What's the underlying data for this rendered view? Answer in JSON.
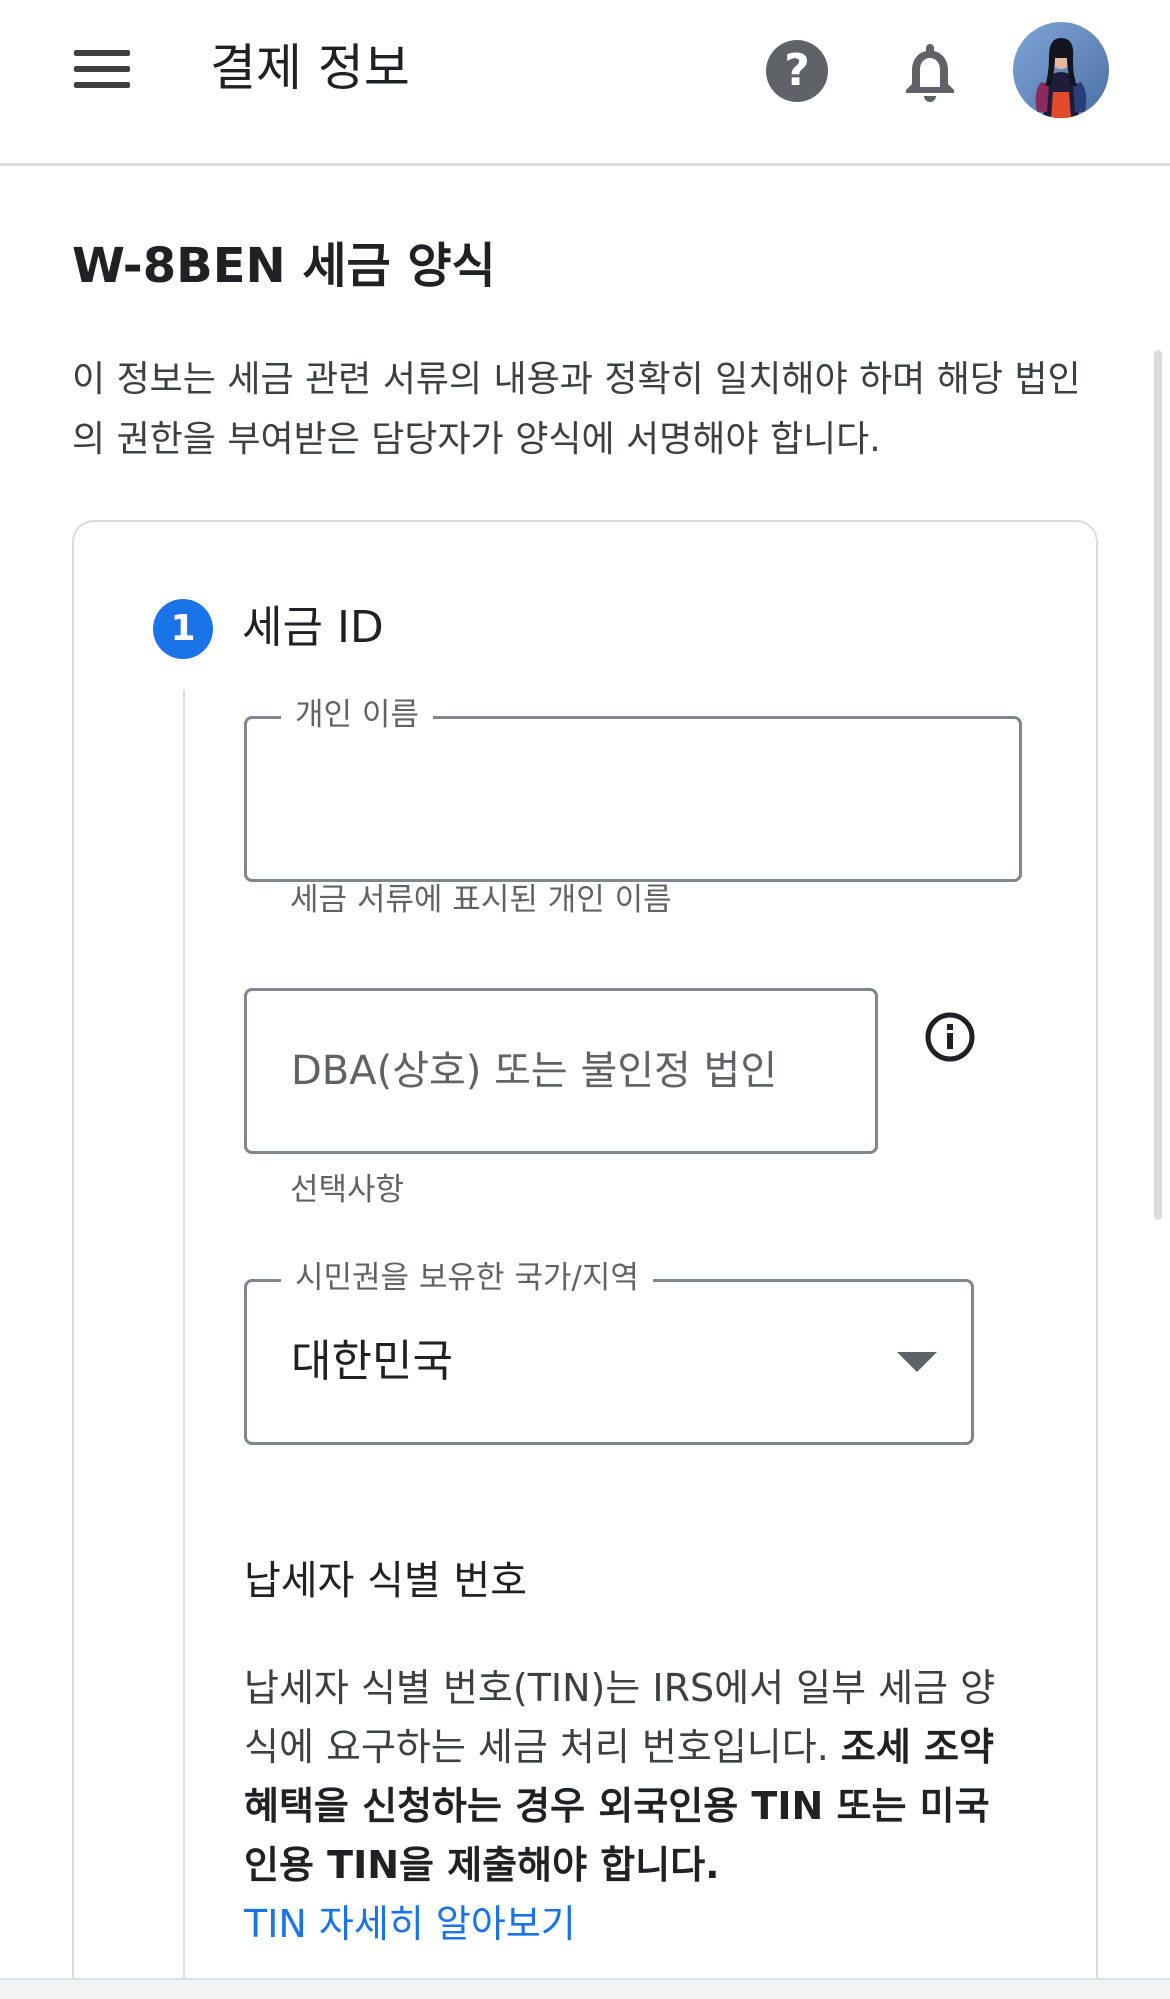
{
  "app_bar": {
    "title": "결제 정보",
    "help_symbol": "?",
    "icons": [
      "menu-icon",
      "help-icon",
      "bell-icon",
      "avatar"
    ]
  },
  "page": {
    "title": "W-8BEN 세금 양식",
    "intro": "이 정보는 세금 관련 서류의 내용과 정확히 일치해야 하며 해당 법인의 권한을 부여받은 담당자가 양식에 서명해야 합니다."
  },
  "step": {
    "number": "1",
    "title": "세금 ID"
  },
  "fields": {
    "individual_name": {
      "label": "개인 이름",
      "value": "",
      "helper": "세금 서류에 표시된 개인 이름"
    },
    "dba": {
      "placeholder": "DBA(상호) 또는 불인정 법인",
      "helper": "선택사항",
      "info_icon": "info-icon"
    },
    "country": {
      "label": "시민권을 보유한 국가/지역",
      "value": "대한민국",
      "icon": "dropdown-arrow-icon"
    }
  },
  "tin": {
    "heading": "납세자 식별 번호",
    "desc_plain": "납세자 식별 번호(TIN)는 IRS에서 일부 세금 양식에 요구하는 세금 처리 번호입니다. ",
    "desc_bold": "조세 조약 혜택을 신청하는 경우 외국인용 TIN 또는 미국인용 TIN을 제출해야 합니다.",
    "link": "TIN 자세히 알아보기"
  },
  "colors": {
    "accent": "#1a73e8",
    "text_primary": "#202124",
    "text_secondary": "#5f6368",
    "border": "#80868b"
  }
}
